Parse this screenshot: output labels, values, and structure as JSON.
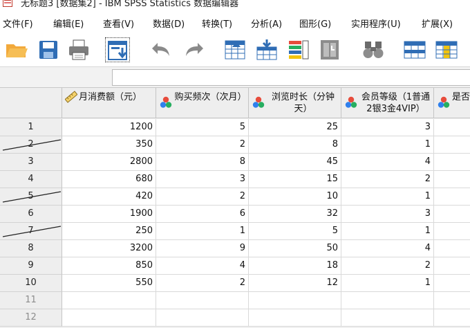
{
  "window": {
    "title": "无标题3 [数据集2] - IBM SPSS Statistics 数据编辑器",
    "icon": "spss-app-icon"
  },
  "menu": [
    "文件(F)",
    "编辑(E)",
    "查看(V)",
    "数据(D)",
    "转换(T)",
    "分析(A)",
    "图形(G)",
    "实用程序(U)",
    "扩展(X)"
  ],
  "toolbar": [
    {
      "icon": "open-folder-icon"
    },
    {
      "icon": "save-icon"
    },
    {
      "icon": "print-icon"
    },
    {
      "icon": "recall-dialog-icon"
    },
    {
      "icon": "undo-icon"
    },
    {
      "icon": "redo-icon"
    },
    {
      "icon": "goto-case-icon"
    },
    {
      "icon": "goto-variable-icon"
    },
    {
      "icon": "variables-icon"
    },
    {
      "icon": "run-descriptives-icon"
    },
    {
      "icon": "find-icon"
    },
    {
      "icon": "insert-cases-icon"
    },
    {
      "icon": "insert-variable-icon"
    }
  ],
  "cell_editor": {
    "value": ""
  },
  "grid": {
    "columns": [
      {
        "name": "月消费额（元）",
        "type": "scale"
      },
      {
        "name": "购买频次（次月）",
        "type": "nominal"
      },
      {
        "name": "浏览时长（分钟天）",
        "type": "nominal"
      },
      {
        "name": "会员等级（1普通2银3金4VIP）",
        "type": "nominal"
      },
      {
        "name": "是否",
        "type": "nominal"
      }
    ],
    "rows": [
      {
        "n": "1",
        "strike": false,
        "values": [
          "1200",
          "5",
          "25",
          "3",
          ""
        ]
      },
      {
        "n": "2",
        "strike": true,
        "values": [
          "350",
          "2",
          "8",
          "1",
          ""
        ]
      },
      {
        "n": "3",
        "strike": false,
        "values": [
          "2800",
          "8",
          "45",
          "4",
          ""
        ]
      },
      {
        "n": "4",
        "strike": false,
        "values": [
          "680",
          "3",
          "15",
          "2",
          ""
        ]
      },
      {
        "n": "5",
        "strike": true,
        "values": [
          "420",
          "2",
          "10",
          "1",
          ""
        ]
      },
      {
        "n": "6",
        "strike": false,
        "values": [
          "1900",
          "6",
          "32",
          "3",
          ""
        ]
      },
      {
        "n": "7",
        "strike": true,
        "values": [
          "250",
          "1",
          "5",
          "1",
          ""
        ]
      },
      {
        "n": "8",
        "strike": false,
        "values": [
          "3200",
          "9",
          "50",
          "4",
          ""
        ]
      },
      {
        "n": "9",
        "strike": false,
        "values": [
          "850",
          "4",
          "18",
          "2",
          ""
        ]
      },
      {
        "n": "10",
        "strike": false,
        "values": [
          "550",
          "2",
          "12",
          "1",
          ""
        ]
      },
      {
        "n": "11",
        "strike": false,
        "values": [
          "",
          "",
          "",
          "",
          ""
        ]
      },
      {
        "n": "12",
        "strike": false,
        "values": [
          "",
          "",
          "",
          "",
          ""
        ]
      }
    ]
  }
}
